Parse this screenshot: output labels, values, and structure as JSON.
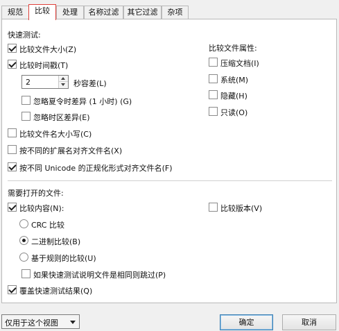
{
  "tabs": [
    {
      "label": "规范"
    },
    {
      "label": "比较"
    },
    {
      "label": "处理"
    },
    {
      "label": "名称过滤"
    },
    {
      "label": "其它过滤"
    },
    {
      "label": "杂项"
    }
  ],
  "quick_test": {
    "heading": "快速测试:",
    "compare_size": {
      "label": "比较文件大小(Z)",
      "checked": true
    },
    "compare_timestamp": {
      "label": "比较时间戳(T)",
      "checked": true
    },
    "tolerance_value": "2",
    "tolerance_label": "秒容差(L)",
    "ignore_dst": {
      "label": "忽略夏令时差异 (1 小时) (G)",
      "checked": false
    },
    "ignore_timezone": {
      "label": "忽略时区差异(E)",
      "checked": false
    },
    "compare_case": {
      "label": "比较文件名大小写(C)",
      "checked": false
    },
    "align_ext": {
      "label": "按不同的扩展名对齐文件名(X)",
      "checked": false
    },
    "align_unicode": {
      "label": "按不同 Unicode 的正规化形式对齐文件名(F)",
      "checked": true
    }
  },
  "attributes": {
    "heading": "比较文件属性:",
    "compressed": {
      "label": "压缩文档(I)",
      "checked": false
    },
    "system": {
      "label": "系统(M)",
      "checked": false
    },
    "hidden": {
      "label": "隐藏(H)",
      "checked": false
    },
    "readonly": {
      "label": "只读(O)",
      "checked": false
    }
  },
  "open_files": {
    "heading": "需要打开的文件:",
    "compare_content": {
      "label": "比较内容(N):",
      "checked": true
    },
    "compare_version": {
      "label": "比较版本(V)",
      "checked": false
    },
    "radio_crc": {
      "label": "CRC 比较",
      "selected": false
    },
    "radio_binary": {
      "label": "二进制比较(B)",
      "selected": true
    },
    "radio_rules": {
      "label": "基于规则的比较(U)",
      "selected": false
    },
    "skip_same": {
      "label": "如果快速测试说明文件是相同则跳过(P)",
      "checked": false
    },
    "override_quick": {
      "label": "覆盖快速测试结果(Q)",
      "checked": true
    }
  },
  "footer": {
    "scope_select": "仅用于这个视图",
    "ok_label": "确定",
    "cancel_label": "取消"
  },
  "colors": {
    "active_tab_border": "#e0413b",
    "default_button_border": "#3c7fb1"
  }
}
